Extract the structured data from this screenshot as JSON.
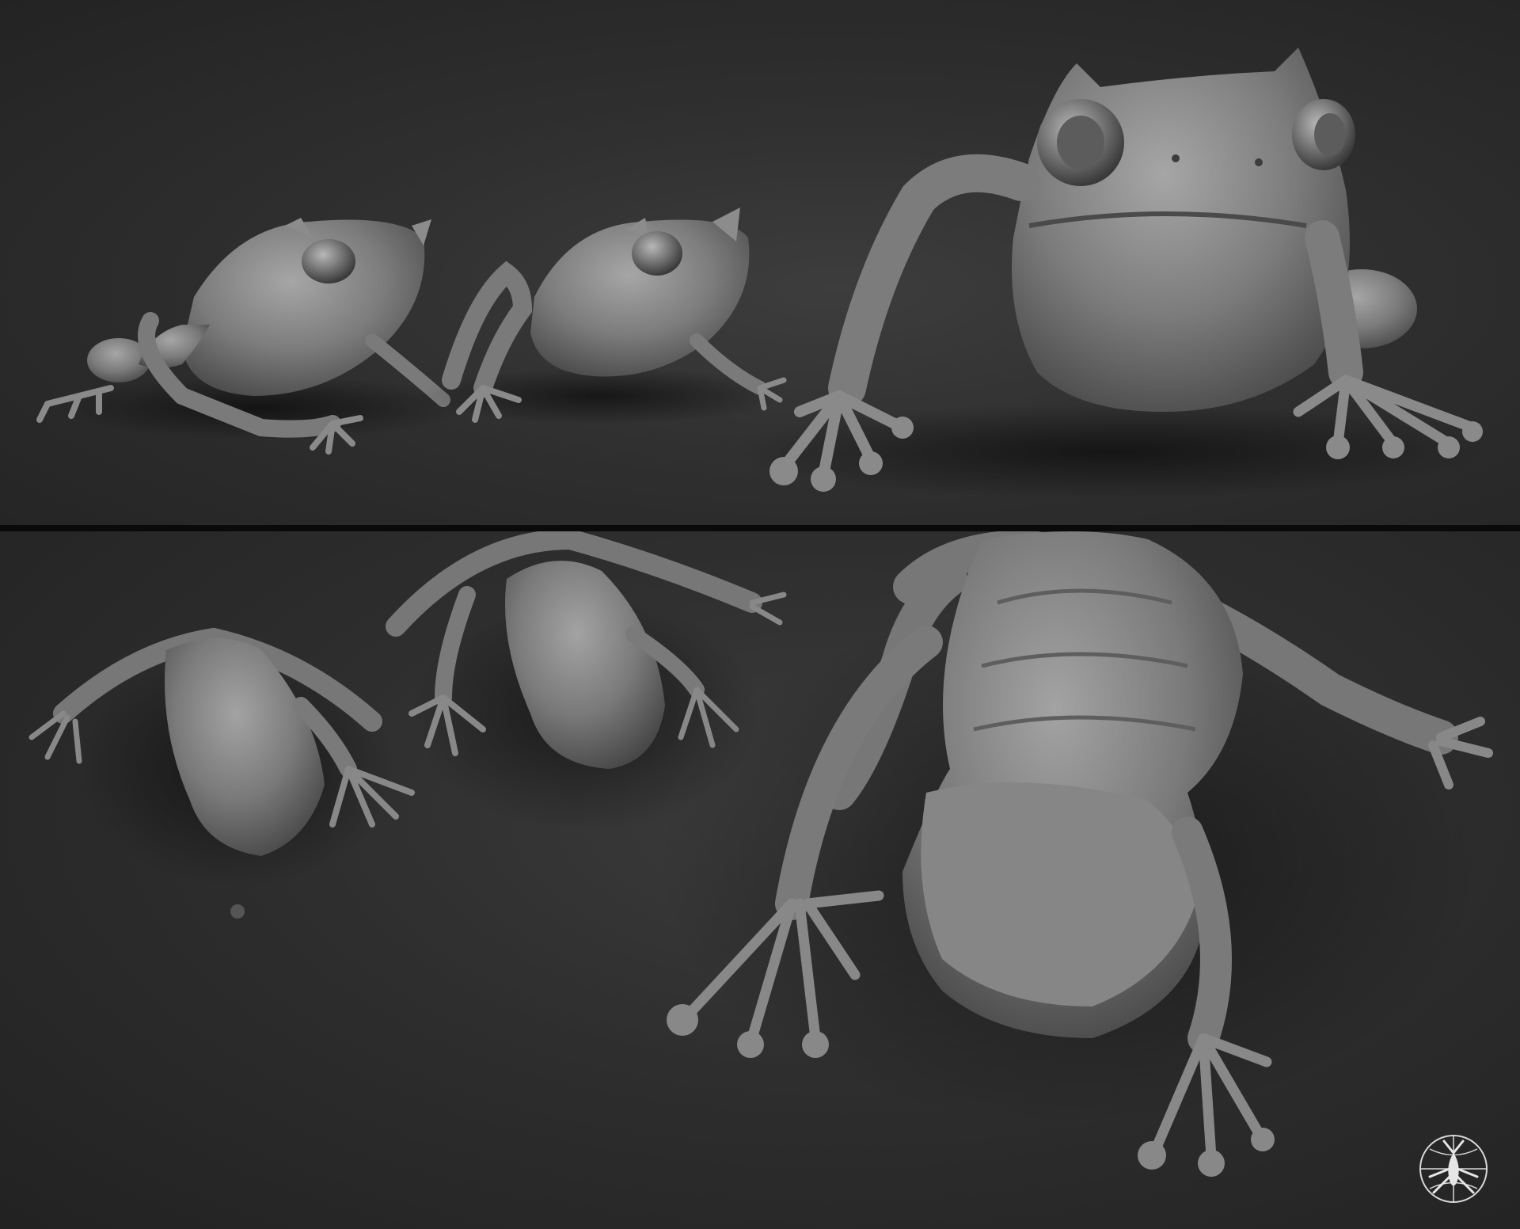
{
  "colors": {
    "background": "#2e2e2e",
    "divider": "#0a0a0a",
    "clay": "#8a8a8a",
    "clay_dark": "#5a5a5a",
    "clay_light": "#a8a8a8"
  },
  "panels": [
    {
      "view": "front-three-quarter",
      "figure_count": 3
    },
    {
      "view": "top-down",
      "figure_count": 3
    }
  ],
  "logo": {
    "icon": "insect-emblem-icon"
  }
}
